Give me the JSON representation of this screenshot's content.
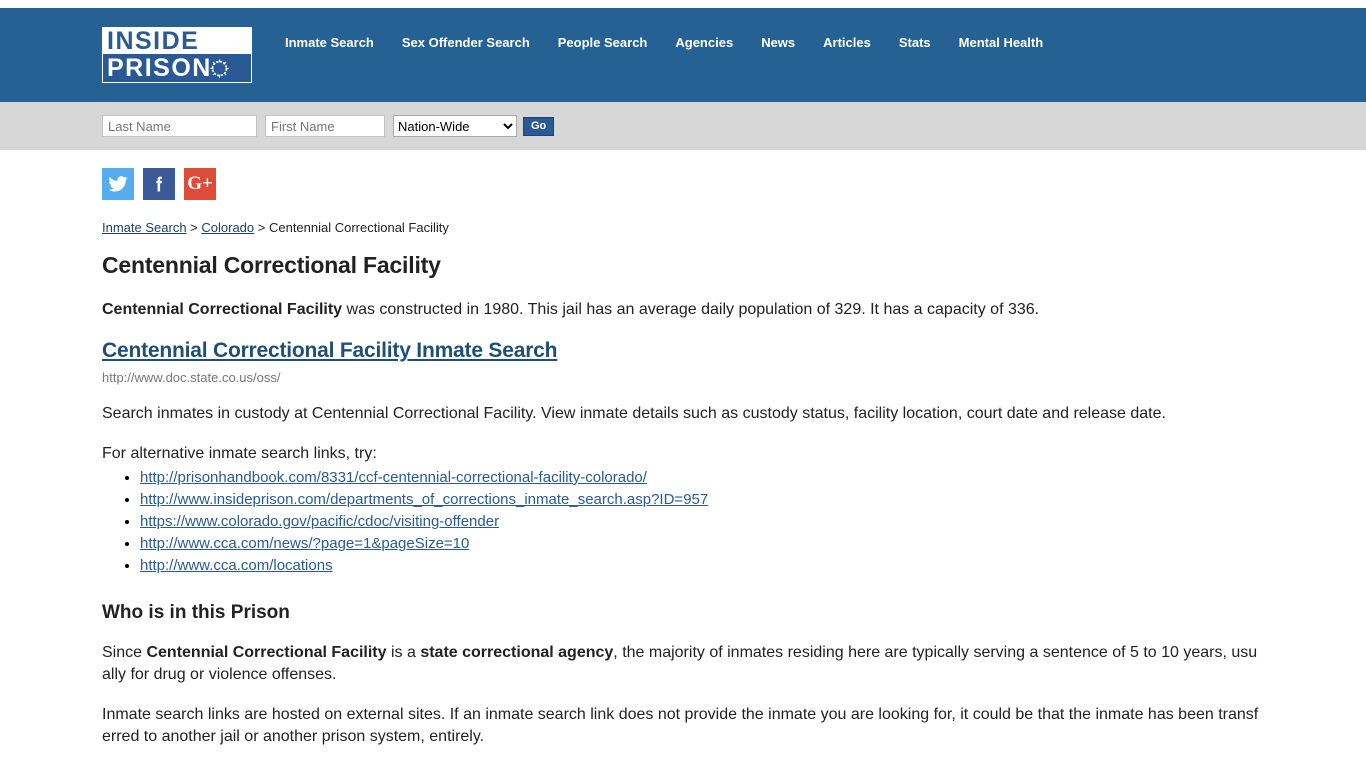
{
  "header": {
    "logo": {
      "line1": "INSIDE",
      "line2": "PRISON",
      "wire_icon": "barbed-wire-circle-icon"
    },
    "nav": [
      {
        "label": "Inmate Search"
      },
      {
        "label": "Sex Offender Search"
      },
      {
        "label": "People Search"
      },
      {
        "label": "Agencies"
      },
      {
        "label": "News"
      },
      {
        "label": "Articles"
      },
      {
        "label": "Stats"
      },
      {
        "label": "Mental Health"
      }
    ],
    "background_color": "#256193"
  },
  "search_bar": {
    "last_name_placeholder": "Last Name",
    "last_name_value": "",
    "first_name_placeholder": "First Name",
    "first_name_value": "",
    "region_selected": "Nation-Wide",
    "region_options": [
      "Nation-Wide"
    ],
    "go_label": "Go"
  },
  "social": [
    {
      "name": "twitter",
      "glyph": "🐦",
      "color": "#55acee"
    },
    {
      "name": "facebook",
      "glyph": "f",
      "color": "#3b5998"
    },
    {
      "name": "googleplus",
      "glyph": "G+",
      "color": "#dd4b39"
    }
  ],
  "breadcrumb": {
    "item1": "Inmate Search",
    "sep1": " > ",
    "item2": "Colorado",
    "sep2": " > ",
    "item3": "Centennial Correctional Facility"
  },
  "main": {
    "page_title": "Centennial Correctional Facility",
    "intro_bold": "Centennial Correctional Facility",
    "intro_rest": " was constructed in 1980. This jail has an average daily population of 329. It has a capacity of 336.",
    "search_link_label": "Centennial Correctional Facility Inmate Search",
    "search_link_url": "http://www.doc.state.co.us/oss/",
    "search_description": "Search inmates in custody at Centennial Correctional Facility. View inmate details such as custody status, facility location, court date and release date.",
    "alt_links_label": "For alternative inmate search links, try:",
    "alt_links": [
      "http://prisonhandbook.com/8331/ccf-centennial-correctional-facility-colorado/",
      "http://www.insideprison.com/departments_of_corrections_inmate_search.asp?ID=957",
      "https://www.colorado.gov/pacific/cdoc/visiting-offender",
      "http://www.cca.com/news/?page=1&pageSize=10",
      "http://www.cca.com/locations"
    ],
    "section_title": "Who is in this Prison",
    "who_part1": "Since ",
    "who_bold1": "Centennial Correctional Facility",
    "who_part2": " is a ",
    "who_bold2": "state correctional agency",
    "who_part3": ", the majority of inmates residing here are typically serving a sentence of 5 to 10 years, usually for drug or violence offenses.",
    "external_note": "Inmate search links are hosted on external sites. If an inmate search link does not provide the inmate you are looking for, it could be that the inmate has been transferred to another jail or another prison system, entirely."
  }
}
